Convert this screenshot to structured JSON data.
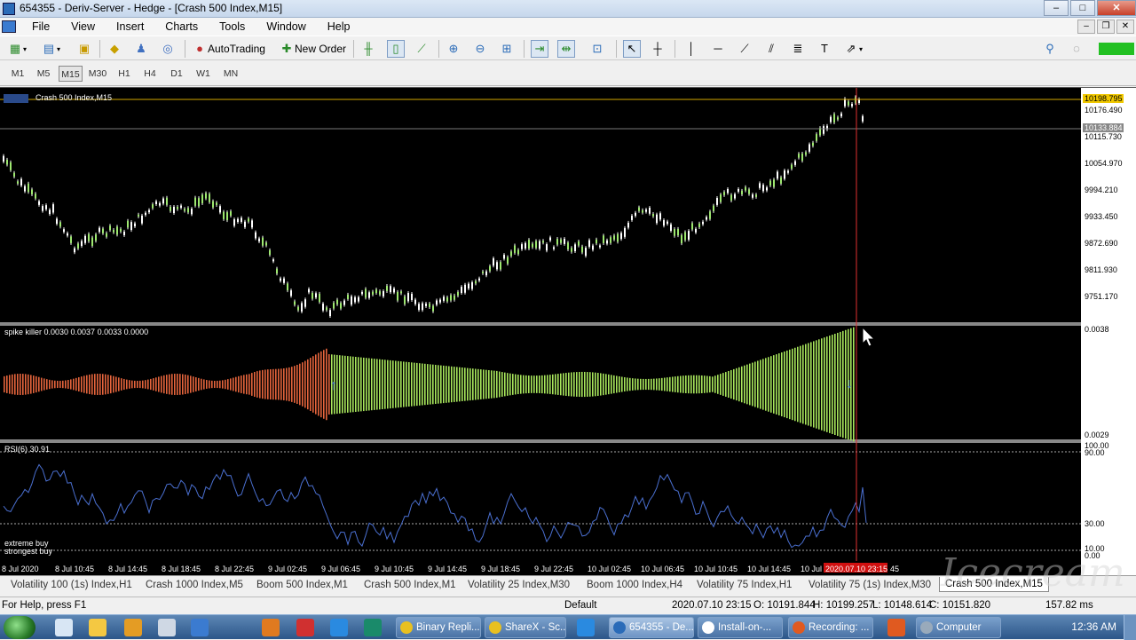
{
  "window": {
    "title": "654355 - Deriv-Server - Hedge - [Crash 500 Index,M15]",
    "min": "–",
    "max": "□",
    "close": "✕"
  },
  "menu": [
    "File",
    "View",
    "Insert",
    "Charts",
    "Tools",
    "Window",
    "Help"
  ],
  "toolbar": {
    "autotrading": "AutoTrading",
    "new_order": "New Order"
  },
  "timeframes": [
    "M1",
    "M5",
    "M15",
    "M30",
    "H1",
    "H4",
    "D1",
    "W1",
    "MN"
  ],
  "active_timeframe": "M15",
  "chart": {
    "label": "Crash 500 Index,M15",
    "price_ticks": [
      "10176.490",
      "10115.730",
      "10054.970",
      "9994.210",
      "9933.450",
      "9872.690",
      "9811.930",
      "9751.170"
    ],
    "price_high_label": "10198.795",
    "price_current_label": "10133.884",
    "indicator_label": "spike killer 0.0030 0.0037 0.0033 0.0000",
    "indicator_ticks": [
      "0.0038",
      "0.0029"
    ],
    "rsi_label": "RSI(6) 30.91",
    "rsi_ticks": [
      "100.00",
      "90.00",
      "30.00",
      "10.00",
      "0.00"
    ],
    "rsi_notes": [
      "extreme buy",
      "strongest buy"
    ],
    "time_labels": [
      "8 Jul 2020",
      "8 Jul 10:45",
      "8 Jul 14:45",
      "8 Jul 18:45",
      "8 Jul 22:45",
      "9 Jul 02:45",
      "9 Jul 06:45",
      "9 Jul 10:45",
      "9 Jul 14:45",
      "9 Jul 18:45",
      "9 Jul 22:45",
      "10 Jul 02:45",
      "10 Jul 06:45",
      "10 Jul 10:45",
      "10 Jul 14:45",
      "10 Jul",
      "45"
    ],
    "cursor_time": "2020.07.10 23:15"
  },
  "symbol_tabs": [
    "Volatility 100 (1s) Index,H1",
    "Crash 1000 Index,M5",
    "Boom 500 Index,M1",
    "Crash 500 Index,M1",
    "Volatility 25 Index,M30",
    "Boom 1000 Index,H4",
    "Volatility 75 Index,H1",
    "Volatility 75 (1s) Index,M30",
    "Crash 500 Index,M15"
  ],
  "status": {
    "help": "For Help, press F1",
    "profile": "Default",
    "time": "2020.07.10 23:15",
    "open": "O: 10191.844",
    "high": "H: 10199.257",
    "low": "L: 10148.614",
    "close": "C: 10151.820",
    "ping": "157.82 ms"
  },
  "taskbar": {
    "tasks": [
      "Binary Repli...",
      "ShareX - Sc...",
      "654355 - De...",
      "Install-on-...",
      "Recording: ...",
      "Computer"
    ],
    "clock": "12:36 AM"
  },
  "watermark": "Icecream"
}
